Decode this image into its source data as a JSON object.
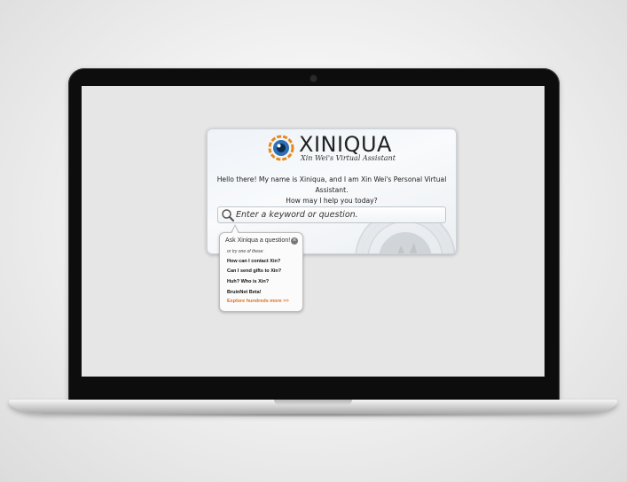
{
  "assistant": {
    "logo_name": "XINIQUA",
    "logo_tagline": "Xin Wei's Virtual Assistant",
    "greeting_line1": "Hello there! My name is Xiniqua, and I am Xin Wei's Personal Virtual Assistant.",
    "greeting_line2": "How may I help you today?",
    "search_placeholder": "Enter a keyword or question."
  },
  "popup": {
    "title": "Ask Xiniqua a question!",
    "close_symbol": "×",
    "subtitle": "or try one of these:",
    "suggestions": [
      "How can I contact Xin?",
      "Can I send gifts to Xin?",
      "Huh? Who is Xin?",
      "BruinNet Beta!"
    ],
    "explore_link": "Explore hundreds more >>"
  },
  "colors": {
    "link_accent": "#e0701e",
    "logo_eye_orange": "#e58a1f",
    "logo_eye_blue": "#2f6fb3"
  }
}
